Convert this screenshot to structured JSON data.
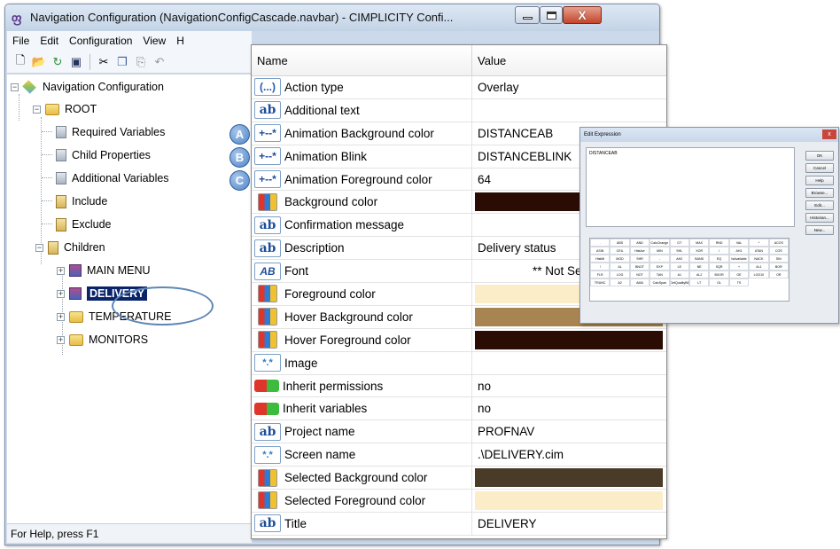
{
  "window": {
    "title": "Navigation Configuration (NavigationConfigCascade.navbar) - CIMPLICITY Confi...",
    "app_icon": "cimplicity-icon"
  },
  "menu": [
    "File",
    "Edit",
    "Configuration",
    "View",
    "H"
  ],
  "toolbar": [
    "new-icon",
    "open-icon",
    "refresh-icon",
    "save-icon",
    "cut-icon",
    "copy-icon",
    "paste-icon",
    "undo-icon"
  ],
  "tree": {
    "root": "Navigation Configuration",
    "folder_root": "ROOT",
    "required_variables": "Required Variables",
    "child_properties": "Child Properties",
    "additional_variables": "Additional Variables",
    "include": "Include",
    "exclude": "Exclude",
    "children": "Children",
    "main_menu": "MAIN MENU",
    "delivery": "DELIVERY",
    "temperature": "TEMPERATURE",
    "monitors": "MONITORS"
  },
  "status_bar": "For Help, press F1",
  "properties": {
    "header_name": "Name",
    "header_value": "Value",
    "rows": [
      {
        "type": "expr",
        "name": "Action type",
        "value": "Overlay"
      },
      {
        "type": "ab",
        "name": "Additional text",
        "value": ""
      },
      {
        "type": "anim",
        "name": "Animation Background color",
        "value": "DISTANCEAB"
      },
      {
        "type": "anim",
        "name": "Animation Blink",
        "value": "DISTANCEBLINK"
      },
      {
        "type": "anim",
        "name": "Animation Foreground color",
        "value": "64"
      },
      {
        "type": "color",
        "name": "Background color",
        "value": "",
        "swatch": "#2a0c05"
      },
      {
        "type": "ab",
        "name": "Confirmation message",
        "value": ""
      },
      {
        "type": "ab",
        "name": "Description",
        "value": "Delivery status"
      },
      {
        "type": "font",
        "name": "Font",
        "value": "** Not Set **"
      },
      {
        "type": "color",
        "name": "Foreground color",
        "value": "",
        "swatch": "#fbedc8"
      },
      {
        "type": "color",
        "name": "Hover Background color",
        "value": "",
        "swatch": "#a88550"
      },
      {
        "type": "color",
        "name": "Hover Foreground color",
        "value": "",
        "swatch": "#2a0c05"
      },
      {
        "type": "img",
        "name": "Image",
        "value": ""
      },
      {
        "type": "toggle",
        "name": "Inherit permissions",
        "value": "no"
      },
      {
        "type": "toggle",
        "name": "Inherit variables",
        "value": "no"
      },
      {
        "type": "ab",
        "name": "Project name",
        "value": "PROFNAV"
      },
      {
        "type": "img",
        "name": "Screen name",
        "value": ".\\DELIVERY.cim"
      },
      {
        "type": "color",
        "name": "Selected Background color",
        "value": "",
        "swatch": "#4a3a28"
      },
      {
        "type": "color",
        "name": "Selected Foreground color",
        "value": "",
        "swatch": "#fbedc8"
      },
      {
        "type": "ab",
        "name": "Title",
        "value": "DELIVERY"
      }
    ],
    "type_glyphs": {
      "expr": "(...)",
      "ab": "ab",
      "anim": "+--*",
      "font": "AB",
      "img": "*.*"
    }
  },
  "callouts": [
    "A",
    "B",
    "C"
  ],
  "edit_expression_dialog": {
    "title": "Edit Expression",
    "expression": "DISTANCEAB",
    "buttons": [
      "OK",
      "Cancel",
      "Help",
      "Browse...",
      "Edit...",
      "Historian...",
      "New..."
    ],
    "functions": [
      ".",
      "ABS",
      "AND",
      "CalcChange",
      "GT",
      "MAX",
      "RND",
      "VAL",
      "*",
      "ACOS",
      "ASIN",
      "CEIL",
      "HistAvr",
      "MIN",
      "SHL",
      "XOR",
      "/",
      "AH1",
      "ATAN",
      "COS",
      "HistMi",
      "MOD",
      "SHR",
      "-",
      "AH2",
      "BAND",
      "EQ",
      "IsAvailable",
      "NACK",
      "SIN",
      "!",
      "AL",
      "BNOT",
      "EXP",
      "LE",
      "NE",
      "SQR",
      "+",
      "AL1",
      "BOR",
      "FLR",
      "LOG",
      "NOT",
      "TAN",
      "A1",
      "AL2",
      "BXOR",
      "GE",
      "LOG10",
      "OR",
      "TRUNC",
      "A2",
      "AMA",
      "CalcSpan",
      "GetQualityBit",
      "LT",
      "GL",
      "TS"
    ]
  },
  "colors": {
    "selection": "#0a246a",
    "callout": "#4f86c9",
    "window_frame": "#cbd9ea"
  }
}
